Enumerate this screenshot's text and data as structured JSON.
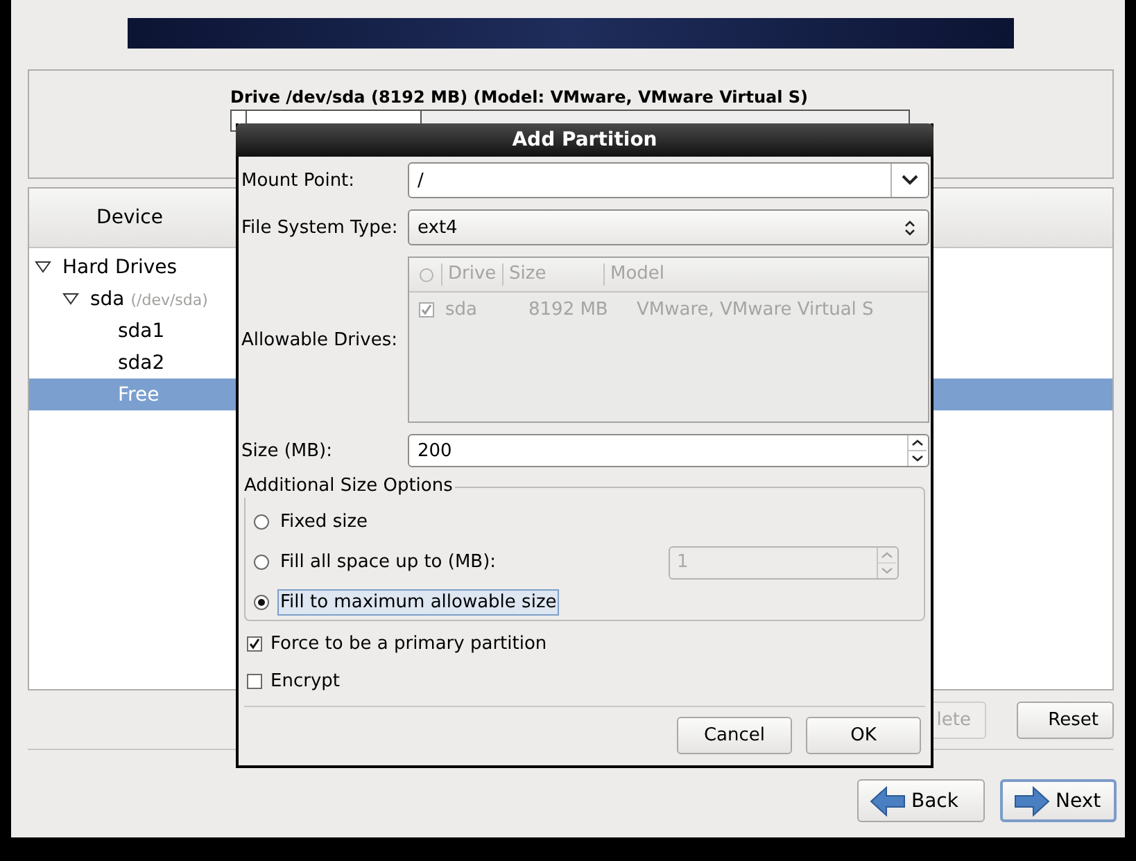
{
  "drive_panel": {
    "title": "Drive /dev/sda (8192 MB) (Model: VMware, VMware Virtual S)"
  },
  "device_list": {
    "columns": [
      "Device"
    ],
    "tree": [
      {
        "label": "Hard Drives",
        "expanded": true,
        "selected": false,
        "children": [
          {
            "label": "sda",
            "hint": "(/dev/sda)",
            "expanded": true,
            "selected": false,
            "children": [
              {
                "label": "sda1",
                "selected": false
              },
              {
                "label": "sda2",
                "selected": false
              },
              {
                "label": "Free",
                "selected": true
              }
            ]
          }
        ]
      }
    ]
  },
  "list_buttons": [
    {
      "label": "lete",
      "disabled": true
    },
    {
      "label": "Reset",
      "disabled": false
    }
  ],
  "nav_buttons": [
    {
      "label": "Back",
      "kind": "back",
      "default": false
    },
    {
      "label": "Next",
      "kind": "next",
      "default": true
    }
  ],
  "dialog": {
    "title": "Add Partition",
    "mount_point": {
      "label": "Mount Point:",
      "value": "/"
    },
    "file_system_type": {
      "label": "File System Type:",
      "value": "ext4"
    },
    "allowable_drives": {
      "label": "Allowable Drives:",
      "disabled": true,
      "columns": [
        "Drive",
        "Size",
        "Model"
      ],
      "rows": [
        {
          "checked": true,
          "cells": [
            "sda",
            "8192 MB",
            "VMware, VMware Virtual S"
          ]
        }
      ]
    },
    "size": {
      "label": "Size (MB):",
      "value": "200"
    },
    "size_options": {
      "title": "Additional Size Options",
      "options": [
        {
          "label": "Fixed size",
          "selected": false
        },
        {
          "label": "Fill all space up to (MB):",
          "selected": false,
          "spin": {
            "value": "1",
            "disabled": true
          }
        },
        {
          "label": "Fill to maximum allowable size",
          "selected": true
        }
      ]
    },
    "checks": [
      {
        "label": "Force to be a primary partition",
        "checked": true
      },
      {
        "label": "Encrypt",
        "checked": false
      }
    ],
    "buttons": [
      {
        "label": "Cancel"
      },
      {
        "label": "OK"
      }
    ]
  }
}
